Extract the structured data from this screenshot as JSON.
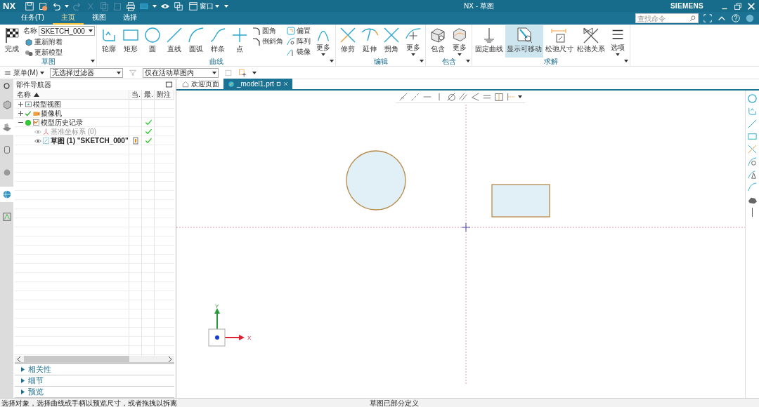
{
  "title_bar": {
    "logo": "NX",
    "window_menu": "窗口",
    "title": "NX - 草图",
    "brand": "SIEMENS"
  },
  "tabs": [
    {
      "label": "任务(T)",
      "selected": false
    },
    {
      "label": "主页",
      "selected": true
    },
    {
      "label": "视图",
      "selected": false
    },
    {
      "label": "选择",
      "selected": false
    }
  ],
  "search": {
    "placeholder": "查找命令"
  },
  "ribbon": [
    {
      "label": "草图",
      "items": [
        {
          "kind": "large",
          "label": "完成"
        },
        {
          "kind": "stack",
          "items": [
            {
              "kind": "field",
              "label": "名称",
              "value": "SKETCH_000"
            },
            {
              "kind": "button",
              "label": "重新附着"
            },
            {
              "kind": "button",
              "label": "更新模型"
            }
          ]
        }
      ]
    },
    {
      "label": "曲线",
      "items": [
        {
          "kind": "large",
          "label": "轮廓"
        },
        {
          "kind": "large",
          "label": "矩形"
        },
        {
          "kind": "large",
          "label": "圆"
        },
        {
          "kind": "large",
          "label": "直线"
        },
        {
          "kind": "large",
          "label": "圆弧"
        },
        {
          "kind": "large",
          "label": "样条"
        },
        {
          "kind": "large",
          "label": "点"
        },
        {
          "kind": "stack",
          "items": [
            {
              "kind": "button",
              "label": "圆角"
            },
            {
              "kind": "button",
              "label": "倒斜角"
            }
          ]
        },
        {
          "kind": "stack",
          "items": [
            {
              "kind": "button",
              "label": "偏置"
            },
            {
              "kind": "button",
              "label": "阵列"
            },
            {
              "kind": "button",
              "label": "镜像"
            }
          ]
        },
        {
          "kind": "more",
          "label": "更多"
        }
      ]
    },
    {
      "label": "编辑",
      "items": [
        {
          "kind": "large",
          "label": "修剪"
        },
        {
          "kind": "large",
          "label": "延伸"
        },
        {
          "kind": "large",
          "label": "拐角"
        },
        {
          "kind": "more",
          "label": "更多"
        }
      ]
    },
    {
      "label": "包含",
      "items": [
        {
          "kind": "large",
          "label": "包含"
        },
        {
          "kind": "more",
          "label": "更多"
        }
      ]
    },
    {
      "label": "求解",
      "items": [
        {
          "kind": "large",
          "label": "固定曲线",
          "on": false
        },
        {
          "kind": "large",
          "label": "显示可移动",
          "on": true
        },
        {
          "kind": "large",
          "label": "松弛尺寸",
          "on": false
        },
        {
          "kind": "large",
          "label": "松弛关系",
          "on": false
        },
        {
          "kind": "more",
          "label": "选项",
          "on": false
        }
      ]
    }
  ],
  "toolbar": {
    "menu": "菜单(M)",
    "filter": "无选择过滤器",
    "scope": "仅在活动草图内"
  },
  "navigator": {
    "title": "部件导航器",
    "columns": [
      "名称",
      "当.",
      "最.",
      "附注"
    ],
    "rows": [
      {
        "label": "模型视图",
        "expanded": false,
        "latest": false,
        "current": false,
        "disabled": false,
        "active": false
      },
      {
        "label": "摄像机",
        "expanded": false,
        "latest": false,
        "current": false,
        "disabled": false,
        "active": false
      },
      {
        "label": "模型历史记录",
        "expanded": true,
        "latest": true,
        "current": false,
        "disabled": false,
        "active": false,
        "children": [
          {
            "label": "基准坐标系 (0)",
            "latest": true,
            "current": false,
            "disabled": true,
            "active": false
          },
          {
            "label": "草图 (1) \"SKETCH_000\"",
            "latest": true,
            "current": true,
            "disabled": false,
            "active": true
          }
        ]
      }
    ],
    "sections": [
      {
        "label": "相关性",
        "expanded": false
      },
      {
        "label": "细节",
        "expanded": false
      },
      {
        "label": "预览",
        "expanded": false
      }
    ]
  },
  "doc_tabs": [
    {
      "label": "欢迎页面",
      "selected": false
    },
    {
      "label": "_model1.prt",
      "selected": true
    }
  ],
  "canvas": {
    "triad": {
      "y": "Y",
      "x": "X"
    }
  },
  "status_bar": {
    "prompt": "选择对象，选择曲线或手柄以预览尺寸，或者拖拽以拆离",
    "state": "草图已部分定义"
  }
}
